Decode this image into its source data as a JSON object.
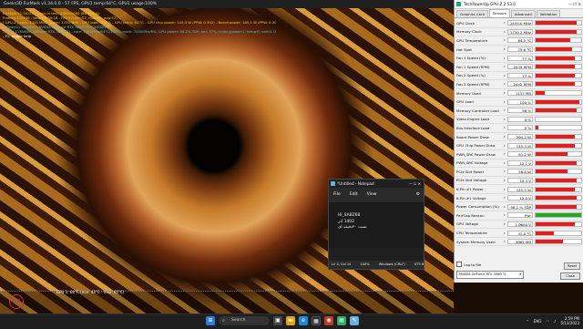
{
  "furmark": {
    "title": "Geeks3D FurMark v1.34.0.0 - 57 FPS, GPU1 temp:64°C, GPU1 usage:100%",
    "hud": [
      {
        "text": "FurMark v1.34.0.0 - Burn-in test, 1920x1080 (8X MSAA)",
        "color": "#f0d000"
      },
      {
        "text": "Frames:134136 - time:00:39:18 - FPS:57(min:57, max:92, avg:57)",
        "color": "#f0d000"
      },
      {
        "text": "[ GPU-Z ] core: 1455 MHz - mem: 1750 MHz - GPU load: 100 % - GPU temp: 64 °C - GPU chip power: 145.3 W (PPW: 0.392) - Board power: 185.1 W (PPW: 0.307) - GPU voltage: 0.701 V",
        "color": "#f0d000"
      },
      {
        "text": "> OpenGL renderer: NVIDIA GeForce RTX 3060 Ti/PCIe/SSE2",
        "color": "#30d0f0"
      },
      {
        "text": "> GPU 1 (NVIDIA GeForce RTX 3060 Ti) - core: 1455MHz/64°C/100%, mem: 7000MHz/6%, GPU power: 98.2% TDP, fan: 77%, limits:[power:1, temp:0, volt:0, OV:0]",
        "color": "#30d0f0"
      },
      {
        "text": "- F1: toggle help",
        "color": "#ffffff"
      }
    ],
    "graph_label": "GPU 1: 64°C (min: 43°C - max: 65°C)",
    "logo_text": "FM"
  },
  "gpuz": {
    "title": "TechPowerUp GPU-Z 2.53.0",
    "window_controls": "— ☐ ✕",
    "tabs": [
      "Graphics Card",
      "Sensors",
      "Advanced",
      "Validation"
    ],
    "active_tab": "Sensors",
    "sensors": [
      {
        "label": "GPU Clock",
        "value": "1455.0 MHz",
        "level": 0.9
      },
      {
        "label": "Memory Clock",
        "value": "1750.2 MHz",
        "level": 0.9
      },
      {
        "label": "GPU Temperature",
        "value": "64.5 °C",
        "level": 0.75
      },
      {
        "label": "Hot Spot",
        "value": "75.6 °C",
        "level": 0.8
      },
      {
        "label": "Fan 1 Speed (%)",
        "value": "77 %",
        "level": 0.85
      },
      {
        "label": "Fan 1 Speed (RPM)",
        "value": "2039 RPM",
        "level": 0.85
      },
      {
        "label": "Fan 2 Speed (%)",
        "value": "77 %",
        "level": 0.85
      },
      {
        "label": "Fan 2 Speed (RPM)",
        "value": "2042 RPM",
        "level": 0.85
      },
      {
        "label": "Memory Used",
        "value": "1157 MB",
        "level": 0.2
      },
      {
        "label": "GPU Load",
        "value": "100 %",
        "level": 0.95
      },
      {
        "label": "Memory Controller Load",
        "value": "96 %",
        "level": 0.9
      },
      {
        "label": "Video Engine Load",
        "value": "0 %",
        "level": 0.0
      },
      {
        "label": "Bus Interface Load",
        "value": "2 %",
        "level": 0.05
      },
      {
        "label": "Board Power Draw",
        "value": "204.2 W",
        "level": 0.85
      },
      {
        "label": "GPU Chip Power Draw",
        "value": "145.3 W",
        "level": 0.85
      },
      {
        "label": "PWR_SRC Power Draw",
        "value": "61.2 W",
        "level": 0.7
      },
      {
        "label": "PWR_SRC Voltage",
        "value": "12.1 V",
        "level": 0.9
      },
      {
        "label": "PCIe Slot Power",
        "value": "58.8 W",
        "level": 0.7
      },
      {
        "label": "PCIe Slot Voltage",
        "value": "12.3 V",
        "level": 0.9
      },
      {
        "label": "8-Pin #1 Power",
        "value": "145.5 W",
        "level": 0.85
      },
      {
        "label": "8-Pin #1 Voltage",
        "value": "12.0 V",
        "level": 0.9
      },
      {
        "label": "Power Consumption (%)",
        "value": "98.1 % TDP",
        "level": 0.9
      },
      {
        "label": "PerfCap Reason",
        "value": "Pwr",
        "level": 1.0,
        "color": "#22aa22"
      },
      {
        "label": "GPU Voltage",
        "value": "1.0680 V",
        "level": 0.85
      },
      {
        "label": "CPU Temperature",
        "value": "41.0 °C",
        "level": 0.4
      },
      {
        "label": "System Memory Used",
        "value": "5062 MB",
        "level": 0.6
      }
    ],
    "log_label": "Log to file",
    "reset_label": "Reset",
    "gpu_name": "NVIDIA GeForce RTX 3060 Ti",
    "close_label": "Close"
  },
  "notepad": {
    "title": "*Untitled - Notepad",
    "window_controls": "— ☐ ✕",
    "menu": [
      "File",
      "Edit",
      "View"
    ],
    "content": [
      "HI_SABZ68",
      "1402 آذر",
      "تست ۳۰دقیقه ای"
    ],
    "status": [
      "Ln 3, Col 14",
      "100%",
      "Windows (CRLF)",
      "UTF-8"
    ]
  },
  "taskbar": {
    "weather": "",
    "search_placeholder": "Search",
    "clock_time": "2:59 PM",
    "clock_date": "5/13/2023",
    "tray_text": "ENG"
  }
}
